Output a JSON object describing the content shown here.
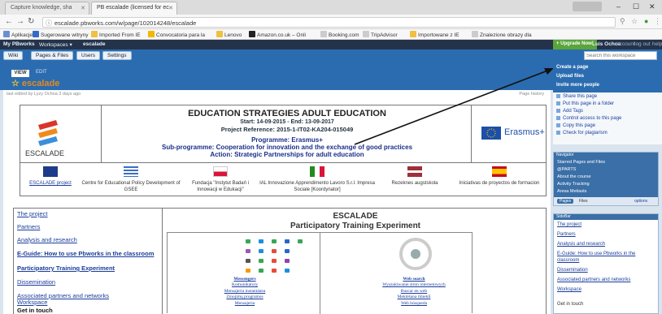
{
  "browser": {
    "tabs": [
      {
        "label": "Capture knowledge, sha",
        "active": false
      },
      {
        "label": "PB escalade (licensed for ec",
        "active": true
      }
    ],
    "window_user": "Zbigniew",
    "url": "escalade.pbworks.com/w/page/102014248/escalade",
    "bookmarks": [
      {
        "label": "Aplikacje",
        "color": "#6a8fd0"
      },
      {
        "label": "Sugerowane witryny",
        "color": "#3569c9"
      },
      {
        "label": "Imported From IE",
        "color": "#f0c040"
      },
      {
        "label": "Convocatoria para la",
        "color": "#f2b705"
      },
      {
        "label": "Lenovo",
        "color": "#f0c040"
      },
      {
        "label": "Amazon.co.uk – Onli",
        "color": "#222222"
      },
      {
        "label": "Booking.com",
        "color": "#cccccc"
      },
      {
        "label": "TripAdvisor",
        "color": "#cccccc"
      },
      {
        "label": "Importowane z IE",
        "color": "#f0c040"
      },
      {
        "label": "Znalezione obrazy dla",
        "color": "#cccccc"
      }
    ]
  },
  "pbworks": {
    "top": {
      "brand": "My PBworks",
      "workspaces": "Workspaces ▾",
      "workspace": "escalade",
      "upgrade": "+ Upgrade Now!",
      "user": "Luis Ochoa",
      "account": "account",
      "logout": "log out",
      "help": "help"
    },
    "toolbar": {
      "wiki": "Wiki",
      "pages_files": "Pages & Files",
      "users": "Users",
      "settings": "Settings",
      "search_placeholder": "Search this workspace"
    },
    "tabs": {
      "view": "VIEW",
      "edit": "EDIT"
    },
    "page_title": "escalade",
    "last_edit": "last edited by Lyzy Ochoa 3 days ago",
    "page_history": "Page history"
  },
  "banner": {
    "title": "EDUCATION STRATEGIES ADULT EDUCATION",
    "dates": "Start: 14-09-2015 - End: 13-09-2017",
    "reference": "Project Reference: 2015-1-IT02-KA204-015049",
    "programme": "Programme: Erasmus+",
    "subprogramme": "Sub-programme: Cooperation for innovation and the exchange of good practices",
    "action": "Action: Strategic Partnerships for adult education",
    "logo_text": "ESCALADE",
    "erasmus": "Erasmus+"
  },
  "partners": [
    {
      "name": "ESCALADE project",
      "flag": "#1d3b8a"
    },
    {
      "name": "Centre for Educational Policy Development of GSEE",
      "flag": "#3b6dc9"
    },
    {
      "name": "Fundacja \"Instytut Badań i Innowacji w Edukacji\"",
      "flag": "#dc143c"
    },
    {
      "name": "IAL Innovazione Apprendimento Lavoro S.r.l. Impresa Sociale [Koordynator]",
      "flag": "#228b22"
    },
    {
      "name": "Rezeknes augstskola",
      "flag": "#9e3039"
    },
    {
      "name": "Iniciativas de proyectos de formacion",
      "flag": "#c60b1e"
    }
  ],
  "left_nav": [
    {
      "label": "The project",
      "bold": false
    },
    {
      "label": "Partners",
      "bold": false
    },
    {
      "label": "Analysis and research",
      "bold": false
    },
    {
      "label": "E-Guide: How to use Pbworks in the classroom",
      "bold": true
    },
    {
      "label": "Participatory Training Experiment",
      "bold": true
    },
    {
      "label": "Dissemination",
      "bold": false
    },
    {
      "label": "Associated partners and networks",
      "bold": false
    },
    {
      "label": "Workspace",
      "bold": false
    }
  ],
  "get_in_touch": "Get in touch",
  "escalade_heading": {
    "title": "ESCALADE",
    "subtitle": "Participatory Training Experiment"
  },
  "app_links": {
    "heading": "Messengers",
    "items": [
      "Komunikatory",
      "Mensajería instantánea",
      "Zinojimų programos",
      "Mensajeria"
    ]
  },
  "web_links": {
    "heading": "Web search",
    "items": [
      "Wyszukiwanie stron internetowych",
      "Buscar en web",
      "Meklēšana tīmeklī",
      "Web búsqueda"
    ]
  },
  "sidebar": {
    "create": [
      "Create a page",
      "Upload files",
      "Invite more people"
    ],
    "menu": [
      "Share this page",
      "Put this page in a folder",
      "Add Tags",
      "Control access to this page",
      "Copy this page",
      "Check for plagiarism"
    ],
    "navigator": {
      "header": "Navigator",
      "items": [
        "Starred Pages and Files",
        "@PARTS",
        "About the course",
        "Activity Tracking",
        "Aresa Metiasts"
      ],
      "pages": "Pages",
      "files": "Files",
      "options": "options"
    },
    "sidebar_widget": {
      "header": "SideBar",
      "links": [
        "The project",
        "Partners",
        "Analysis and research",
        "E-Guide: How to use Pbworks in the classroom",
        "Dissemination",
        "Associated partners and networks",
        "Workspace"
      ],
      "get_in_touch": "Get in touch"
    }
  }
}
